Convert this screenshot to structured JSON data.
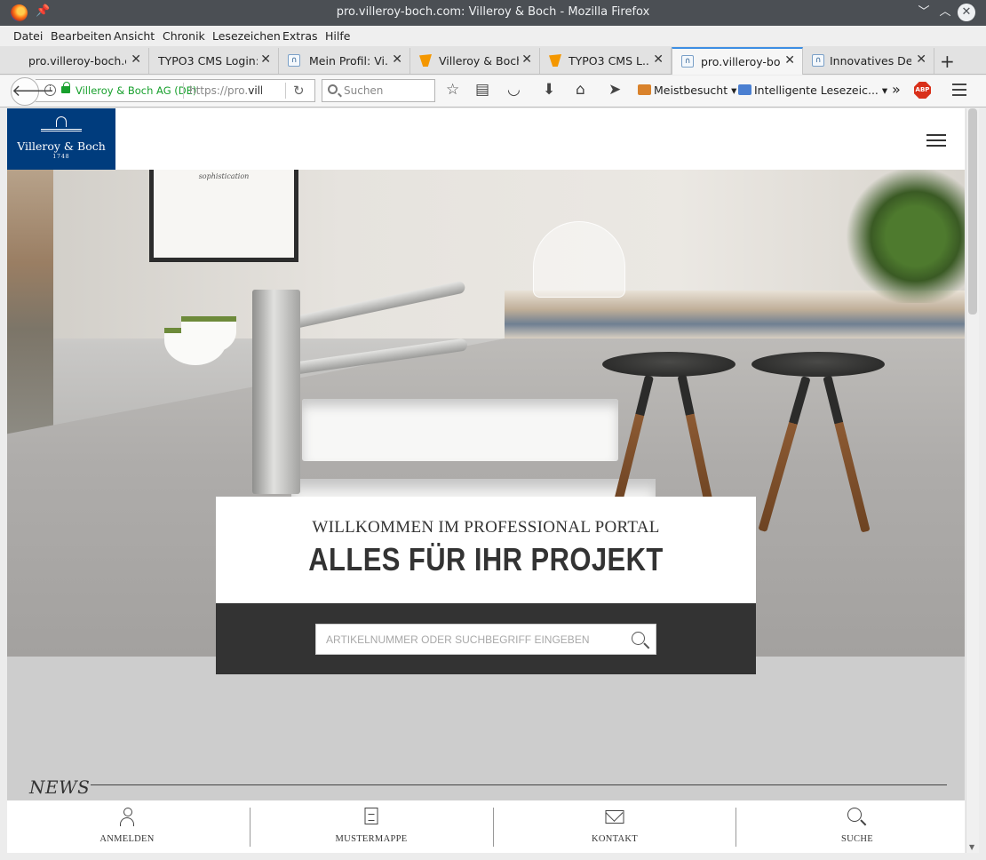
{
  "window": {
    "title": "pro.villeroy-boch.com: Villeroy & Boch - Mozilla Firefox"
  },
  "menubar": [
    "Datei",
    "Bearbeiten",
    "Ansicht",
    "Chronik",
    "Lesezeichen",
    "Extras",
    "Hilfe"
  ],
  "tabs": [
    {
      "label": "pro.villeroy-boch.c...",
      "favicon": "none",
      "active": false
    },
    {
      "label": "TYPO3 CMS Login:...",
      "favicon": "none",
      "active": false
    },
    {
      "label": "Mein Profil:  Vi...",
      "favicon": "vb-icon",
      "active": false
    },
    {
      "label": "Villeroy & Boch...",
      "favicon": "typo3-icon",
      "active": false
    },
    {
      "label": "TYPO3 CMS L...",
      "favicon": "typo3-icon",
      "active": false
    },
    {
      "label": "pro.villeroy-bo...",
      "favicon": "vb-icon",
      "active": true
    },
    {
      "label": "Innovatives De...",
      "favicon": "vb-icon",
      "active": false
    }
  ],
  "navbar": {
    "identity": "Villeroy & Boch AG (DE)",
    "url_prefix": "https://pro.",
    "url_host": "villeı",
    "search_placeholder": "Suchen",
    "bookmarks": [
      {
        "label": "Meistbesucht",
        "icon": "folder-icon",
        "color": "#d9822b"
      },
      {
        "label": "Intelligente Lesezeic...",
        "icon": "folder-icon",
        "color": "#4a7fd1"
      }
    ],
    "overflow": "»",
    "abp": "ABP"
  },
  "site": {
    "logo": {
      "name": "Villeroy & Boch",
      "year": "1748",
      "color": "#003c7d"
    },
    "hero": {
      "frame_text": "sophistication",
      "welcome_sub": "WILLKOMMEN IM PROFESSIONAL PORTAL",
      "welcome_main": "ALLES FÜR IHR PROJEKT",
      "search_placeholder": "ARTIKELNUMMER ODER SUCHBEGRIFF EINGEBEN"
    },
    "news_title": "NEWS",
    "bottom_nav": [
      {
        "label": "ANMELDEN",
        "icon": "user-icon"
      },
      {
        "label": "MUSTERMAPPE",
        "icon": "document-icon"
      },
      {
        "label": "KONTAKT",
        "icon": "mail-icon"
      },
      {
        "label": "SUCHE",
        "icon": "search-icon"
      }
    ]
  }
}
